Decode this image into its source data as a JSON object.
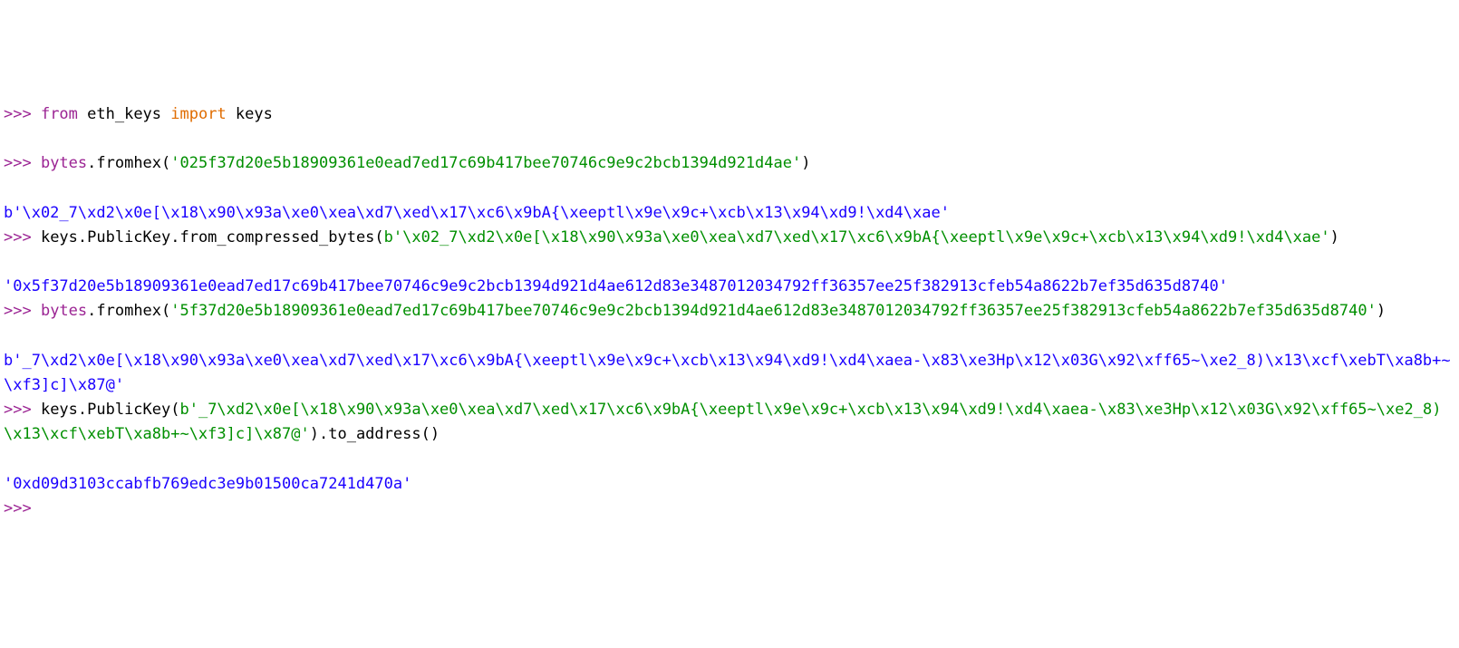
{
  "colors": {
    "prompt_magenta": "#9b2393",
    "import_orange": "#e06c00",
    "string_green": "#008f00",
    "output_blue": "#1a00ff",
    "default_black": "#000000",
    "background": "#ffffff"
  },
  "lines": [
    {
      "type": "input",
      "parts": [
        {
          "cls": "prompt",
          "t": ">>> "
        },
        {
          "cls": "kw-from",
          "t": "from"
        },
        {
          "cls": "name",
          "t": " eth_keys "
        },
        {
          "cls": "kw-import",
          "t": "import"
        },
        {
          "cls": "name",
          "t": " keys"
        }
      ]
    },
    {
      "type": "blank"
    },
    {
      "type": "input",
      "parts": [
        {
          "cls": "prompt",
          "t": ">>> "
        },
        {
          "cls": "kw-from",
          "t": "bytes"
        },
        {
          "cls": "name",
          "t": ".fromhex("
        },
        {
          "cls": "str",
          "t": "'025f37d20e5b18909361e0ead7ed17c69b417bee70746c9e9c2bcb1394d921d4ae'"
        },
        {
          "cls": "name",
          "t": ")"
        }
      ]
    },
    {
      "type": "blank"
    },
    {
      "type": "output",
      "parts": [
        {
          "cls": "out-str",
          "t": "b'\\x02_7\\xd2\\x0e[\\x18\\x90\\x93a\\xe0\\xea\\xd7\\xed\\x17\\xc6\\x9bA{\\xeeptl\\x9e\\x9c+\\xcb\\x13\\x94\\xd9!\\xd4\\xae'"
        }
      ]
    },
    {
      "type": "input",
      "parts": [
        {
          "cls": "prompt",
          "t": ">>> "
        },
        {
          "cls": "name",
          "t": "keys.PublicKey.from_compressed_bytes("
        },
        {
          "cls": "str",
          "t": "b'\\x02_7\\xd2\\x0e[\\x18\\x90\\x93a\\xe0\\xea\\xd7\\xed\\x17\\xc6\\x9bA{\\xeeptl\\x9e\\x9c+\\xcb\\x13\\x94\\xd9!\\xd4\\xae'"
        },
        {
          "cls": "name",
          "t": ")"
        }
      ]
    },
    {
      "type": "blank"
    },
    {
      "type": "output",
      "parts": [
        {
          "cls": "out-str",
          "t": "'0x5f37d20e5b18909361e0ead7ed17c69b417bee70746c9e9c2bcb1394d921d4ae612d83e3487012034792ff36357ee25f382913cfeb54a8622b7ef35d635d8740'"
        }
      ]
    },
    {
      "type": "input",
      "parts": [
        {
          "cls": "prompt",
          "t": ">>> "
        },
        {
          "cls": "kw-from",
          "t": "bytes"
        },
        {
          "cls": "name",
          "t": ".fromhex("
        },
        {
          "cls": "str",
          "t": "'5f37d20e5b18909361e0ead7ed17c69b417bee70746c9e9c2bcb1394d921d4ae612d83e3487012034792ff36357ee25f382913cfeb54a8622b7ef35d635d8740'"
        },
        {
          "cls": "name",
          "t": ")"
        }
      ]
    },
    {
      "type": "blank"
    },
    {
      "type": "output",
      "parts": [
        {
          "cls": "out-str",
          "t": "b'_7\\xd2\\x0e[\\x18\\x90\\x93a\\xe0\\xea\\xd7\\xed\\x17\\xc6\\x9bA{\\xeeptl\\x9e\\x9c+\\xcb\\x13\\x94\\xd9!\\xd4\\xaea-\\x83\\xe3Hp\\x12\\x03G\\x92\\xff65~\\xe2_8)\\x13\\xcf\\xebT\\xa8b+~\\xf3]c]\\x87@'"
        }
      ]
    },
    {
      "type": "input",
      "parts": [
        {
          "cls": "prompt",
          "t": ">>> "
        },
        {
          "cls": "name",
          "t": "keys.PublicKey("
        },
        {
          "cls": "str",
          "t": "b'_7\\xd2\\x0e[\\x18\\x90\\x93a\\xe0\\xea\\xd7\\xed\\x17\\xc6\\x9bA{\\xeeptl\\x9e\\x9c+\\xcb\\x13\\x94\\xd9!\\xd4\\xaea-\\x83\\xe3Hp\\x12\\x03G\\x92\\xff65~\\xe2_8)\\x13\\xcf\\xebT\\xa8b+~\\xf3]c]\\x87@'"
        },
        {
          "cls": "name",
          "t": ").to_address()"
        }
      ]
    },
    {
      "type": "blank"
    },
    {
      "type": "output",
      "parts": [
        {
          "cls": "out-str",
          "t": "'0xd09d3103ccabfb769edc3e9b01500ca7241d470a'"
        }
      ]
    },
    {
      "type": "input",
      "parts": [
        {
          "cls": "prompt",
          "t": ">>> "
        }
      ]
    }
  ]
}
